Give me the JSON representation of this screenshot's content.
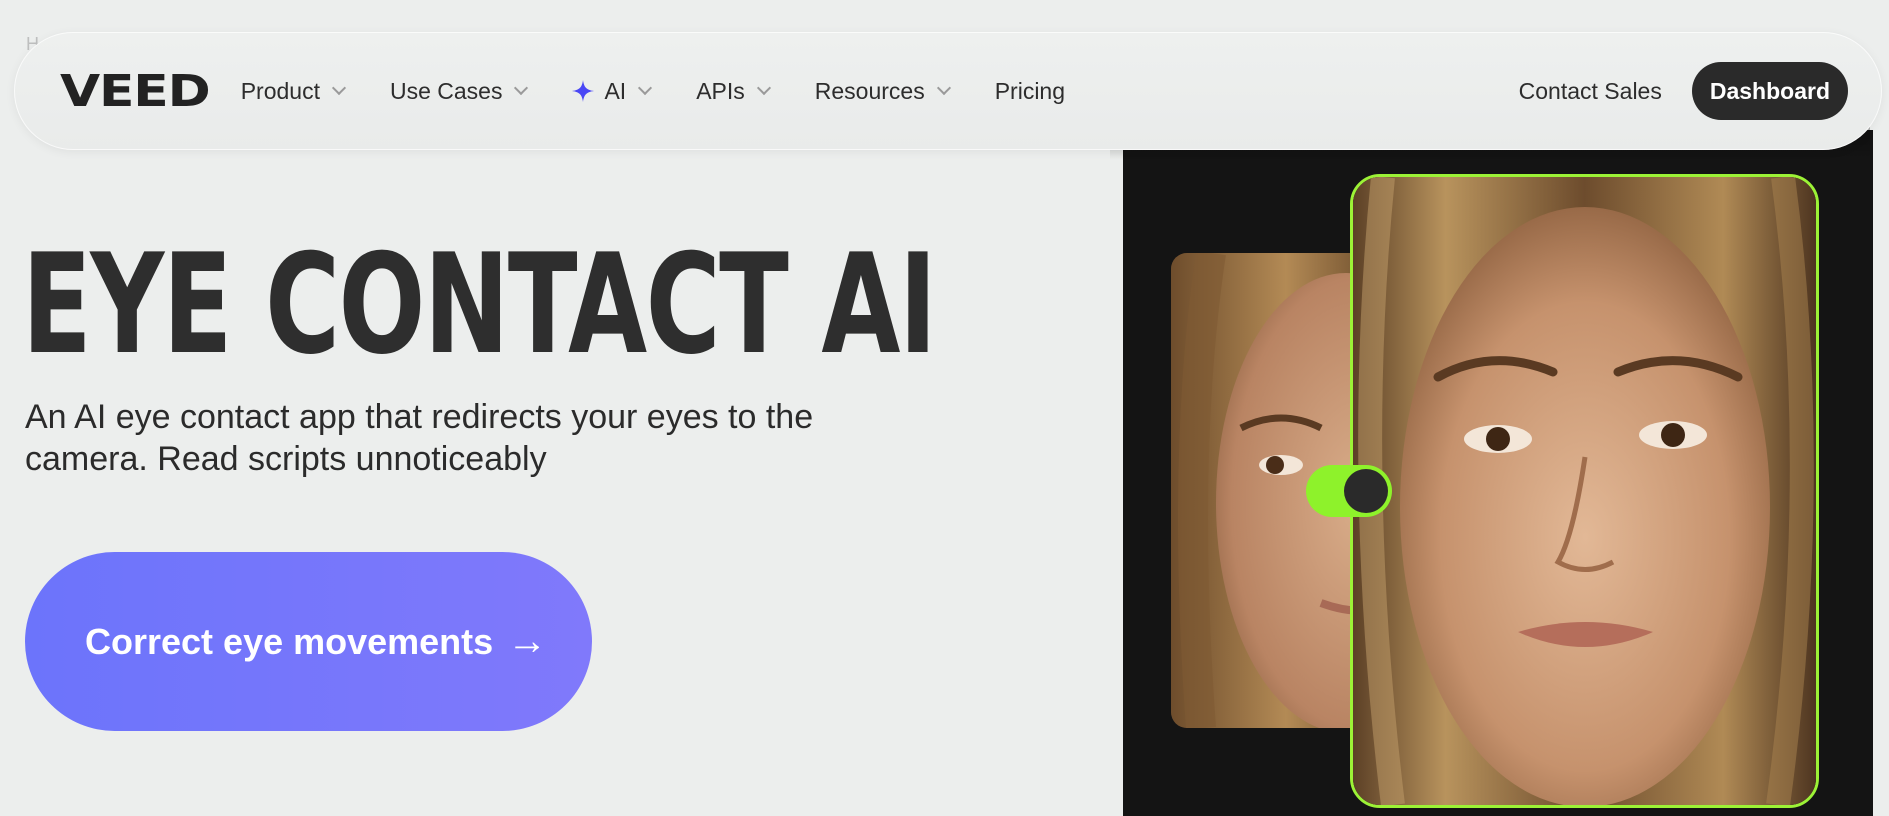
{
  "breadcrumb": {
    "text": "H"
  },
  "navbar": {
    "logo": "VEED",
    "items": [
      {
        "label": "Product",
        "has_dropdown": true
      },
      {
        "label": "Use Cases",
        "has_dropdown": true
      },
      {
        "label": "AI",
        "has_dropdown": true,
        "icon": "sparkle-icon"
      },
      {
        "label": "APIs",
        "has_dropdown": true
      },
      {
        "label": "Resources",
        "has_dropdown": true
      },
      {
        "label": "Pricing",
        "has_dropdown": false
      }
    ],
    "contact_sales": "Contact Sales",
    "dashboard": "Dashboard"
  },
  "hero": {
    "title": "EYE CONTACT AI",
    "subtitle": "An AI eye contact app that redirects your eyes to the camera. Read scripts unnoticeably",
    "cta_label": "Correct eye movements",
    "cta_icon": "arrow-right-icon"
  },
  "colors": {
    "accent_purple": "#6c74fb",
    "accent_green": "#9cf236",
    "dark": "#2a2a2a",
    "background": "#eceeed"
  }
}
